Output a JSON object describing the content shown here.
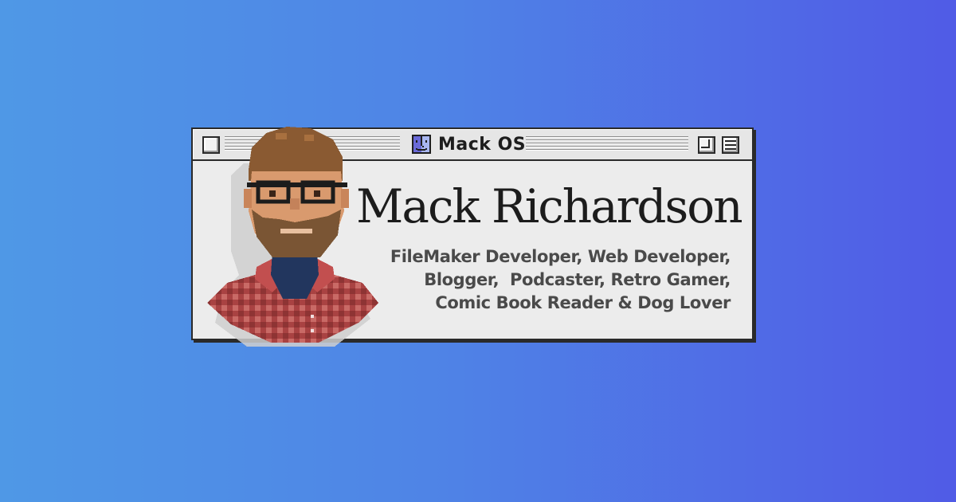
{
  "window": {
    "title": "Mack OS",
    "title_icon": "finder-face-icon",
    "controls": [
      "close-box",
      "zoom-box",
      "collapse-box"
    ]
  },
  "profile": {
    "name": "Mack Richardson",
    "tagline_lines": [
      "FileMaker Developer, Web Developer,",
      "Blogger,  Podcaster, Retro Gamer,",
      "Comic Book Reader & Dog Lover"
    ],
    "avatar": "pixel-art-portrait"
  },
  "colors": {
    "background_start": "#4f98e6",
    "background_end": "#505be6",
    "window_bg": "#ececec",
    "shirt": "#b44a4a",
    "finder_blue": "#6a6ad8"
  }
}
